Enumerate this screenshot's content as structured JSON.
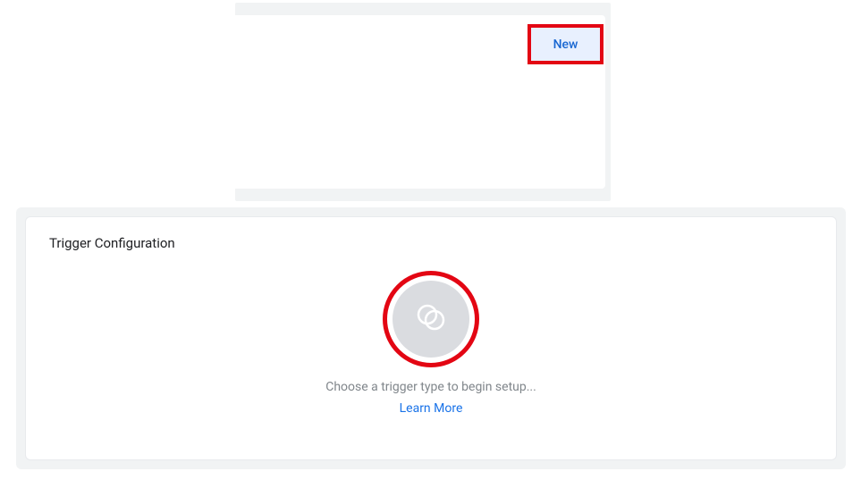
{
  "top": {
    "new_button_label": "New"
  },
  "config": {
    "title": "Trigger Configuration",
    "helper_text": "Choose a trigger type to begin setup...",
    "learn_more_label": "Learn More"
  },
  "highlights": {
    "new_button": true,
    "trigger_icon": true
  },
  "colors": {
    "highlight_border": "#e30613",
    "link": "#1a73e8",
    "button_text": "#1967d2",
    "button_bg": "#e8f0fe",
    "panel_bg": "#f1f3f4",
    "icon_bg": "#dadce0",
    "muted_text": "#80868b"
  }
}
